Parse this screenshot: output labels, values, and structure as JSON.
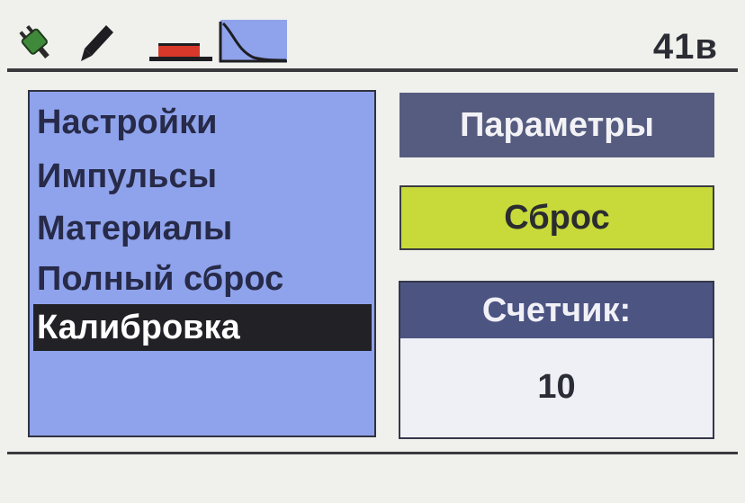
{
  "status": {
    "icons": [
      "plug-icon",
      "pencil-icon",
      "probe-icon",
      "pulse-decay-icon"
    ],
    "voltage": "41в"
  },
  "menu": {
    "items": [
      {
        "label": "Настройки"
      },
      {
        "label": "Импульсы"
      },
      {
        "label": "Материалы"
      },
      {
        "label": "Полный сброс"
      },
      {
        "label": "Калибровка"
      }
    ],
    "selected_index": 4
  },
  "panel": {
    "params_label": "Параметры",
    "reset_label": "Сброс",
    "counter_label": "Счетчик:",
    "counter_value": "10"
  },
  "colors": {
    "menu_bg": "#8fa3ec",
    "params_bg": "#565c80",
    "reset_bg": "#c8d93a",
    "counter_header_bg": "#4c5482",
    "plug_green": "#3f8a3a",
    "probe_red": "#d8382a"
  }
}
